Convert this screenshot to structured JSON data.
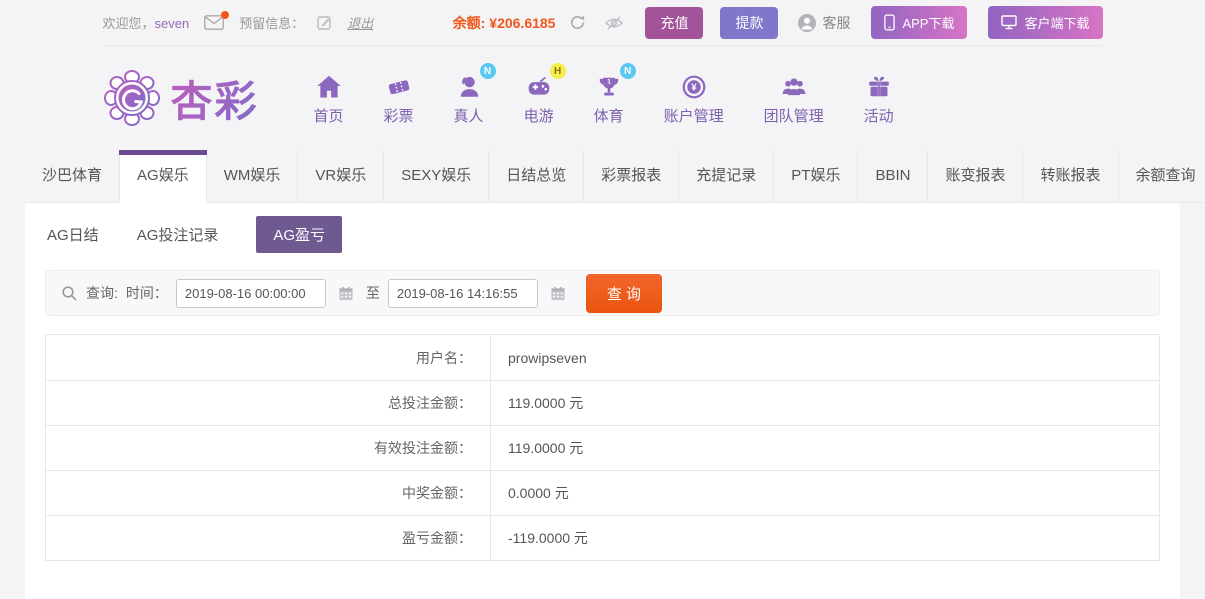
{
  "topbar": {
    "welcome_prefix": "欢迎您，",
    "username": "seven",
    "reserved_label": "预留信息：",
    "logout_label": "退出",
    "balance_label": "余额:",
    "balance_value": "¥206.6185",
    "deposit_label": "充值",
    "withdraw_label": "提款",
    "service_label": "客服",
    "app_download_label": "APP下载",
    "client_download_label": "客户端下载",
    "icons": {
      "mail": "envelope-icon with orange unread dot",
      "edit": "edit-note-icon",
      "refresh": "refresh-icon",
      "hide_balance": "eye-off-icon",
      "service": "headset-avatar-icon",
      "app": "phone-icon",
      "client": "monitor-icon"
    }
  },
  "logo": {
    "text": "杏彩",
    "icon": "flower-swirl-logo"
  },
  "nav": {
    "items": [
      {
        "label": "首页",
        "icon": "home-icon",
        "badge": ""
      },
      {
        "label": "彩票",
        "icon": "ticket-icon",
        "badge": ""
      },
      {
        "label": "真人",
        "icon": "live-person-icon",
        "badge": "N"
      },
      {
        "label": "电游",
        "icon": "gamepad-icon",
        "badge": "H"
      },
      {
        "label": "体育",
        "icon": "trophy-icon",
        "badge": "N"
      },
      {
        "label": "账户管理",
        "icon": "yuan-coin-icon",
        "badge": ""
      },
      {
        "label": "团队管理",
        "icon": "team-icon",
        "badge": ""
      },
      {
        "label": "活动",
        "icon": "gift-icon",
        "badge": ""
      }
    ]
  },
  "tabs": {
    "active": "AG娱乐",
    "items": [
      "沙巴体育",
      "AG娱乐",
      "WM娱乐",
      "VR娱乐",
      "SEXY娱乐",
      "日结总览",
      "彩票报表",
      "充提记录",
      "PT娱乐",
      "BBIN",
      "账变报表",
      "转账报表",
      "余额查询"
    ]
  },
  "subtabs": {
    "active": "AG盈亏",
    "items": [
      "AG日结",
      "AG投注记录",
      "AG盈亏"
    ]
  },
  "query": {
    "search_label": "查询:",
    "time_label": "时间：",
    "from_value": "2019-08-16 00:00:00",
    "between_label": "至",
    "to_value": "2019-08-16 14:16:55",
    "submit_label": "查 询"
  },
  "report": {
    "rows": [
      {
        "label": "用户名：",
        "value": "prowipseven"
      },
      {
        "label": "总投注金额：",
        "value": "119.0000 元"
      },
      {
        "label": "有效投注金额：",
        "value": "119.0000 元"
      },
      {
        "label": "中奖金额：",
        "value": "0.0000 元"
      },
      {
        "label": "盈亏金额：",
        "value": "-119.0000 元"
      }
    ]
  },
  "colors": {
    "brand_purple": "#8b68bd",
    "nav_label_purple": "#7d60ae",
    "active_tab_bar": "#6a4b91",
    "subtab_active_bg": "#6e5a91",
    "deposit_btn": "#a3539a",
    "withdraw_btn": "#8077cb",
    "download_btn_gradient": "#9165c2 → #d874c4",
    "query_btn_orange": "#ea560f",
    "balance_orange": "#f4551b",
    "badge_n_blue": "#5bc9f1",
    "badge_h_yellow": "#f6ef47"
  }
}
